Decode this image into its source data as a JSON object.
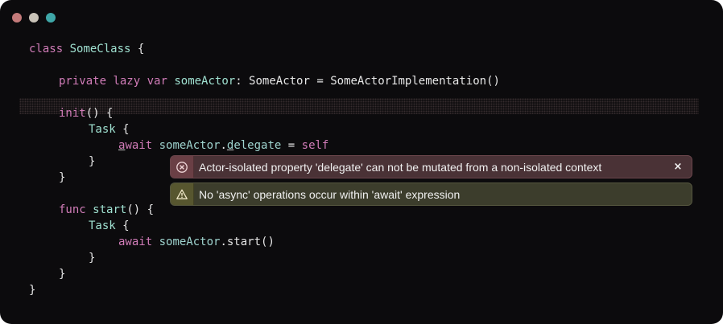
{
  "window": {
    "traffic_lights": [
      "#c47a7a",
      "#c9c3b8",
      "#3fa7a8"
    ]
  },
  "code": {
    "lines": [
      [
        "class",
        " ",
        "SomeClass",
        " {"
      ],
      [
        "private",
        " ",
        "lazy",
        " ",
        "var",
        " ",
        "someActor",
        ": SomeActor = SomeActorImplementation()"
      ],
      [
        "init",
        "() {"
      ],
      [
        "Task",
        " {"
      ],
      [
        "a",
        "wait",
        " ",
        "someActor",
        ".",
        "d",
        "elegate",
        " = ",
        "self"
      ],
      [
        "}"
      ],
      [
        "}"
      ],
      [
        "func",
        " ",
        "start",
        "() {"
      ],
      [
        "Task",
        " {"
      ],
      [
        "await",
        " ",
        "someActor",
        ".start()"
      ],
      [
        "}"
      ],
      [
        "}"
      ],
      [
        "}"
      ]
    ]
  },
  "diagnostics": {
    "error": {
      "message": "Actor-isolated property 'delegate' can not be mutated from a non-isolated context",
      "icon": "error-circle-x-icon",
      "close": "×",
      "color": "#4a3236"
    },
    "warning": {
      "message": "No 'async' operations occur within 'await' expression",
      "icon": "warning-triangle-icon",
      "color": "#3c3d2c"
    }
  },
  "colors": {
    "keyword": "#d17cb8",
    "declaration": "#9fe0d0",
    "background": "#0c0b0d"
  }
}
